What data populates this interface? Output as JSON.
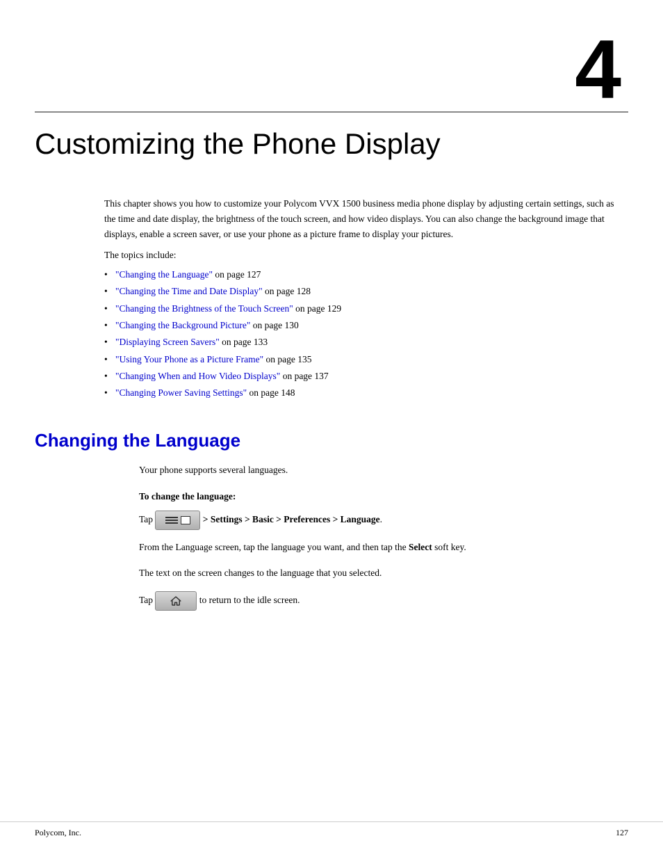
{
  "chapter": {
    "number": "4",
    "title": "Customizing the Phone Display",
    "intro": "This chapter shows you how to customize your Polycom VVX 1500 business media phone display by adjusting certain settings, such as the time and date display, the brightness of the touch screen, and how video displays. You can also change the background image that displays, enable a screen saver, or use your phone as a picture frame to display your pictures.",
    "topics_label": "The topics include:",
    "topics": [
      {
        "link": "\"Changing the Language\"",
        "page_text": " on page ",
        "page": "127"
      },
      {
        "link": "\"Changing the Time and Date Display\"",
        "page_text": " on page ",
        "page": "128"
      },
      {
        "link": "\"Changing the Brightness of the Touch Screen\"",
        "page_text": " on page ",
        "page": "129"
      },
      {
        "link": "\"Changing the Background Picture\"",
        "page_text": " on page ",
        "page": "130"
      },
      {
        "link": "\"Displaying Screen Savers\"",
        "page_text": " on page ",
        "page": "133"
      },
      {
        "link": "\"Using Your Phone as a Picture Frame\"",
        "page_text": " on page ",
        "page": "135"
      },
      {
        "link": "\"Changing When and How Video Displays\"",
        "page_text": " on page ",
        "page": "137"
      },
      {
        "link": "\"Changing Power Saving Settings\"",
        "page_text": " on page ",
        "page": "148"
      }
    ]
  },
  "section": {
    "heading": "Changing the Language",
    "intro": "Your phone supports several languages.",
    "procedure_heading": "To change the language:",
    "step1_pre": "Tap",
    "step1_arrow": ">",
    "step1_post": "Settings > Basic > Preferences > Language",
    "step1_period": ".",
    "step2": "From the Language screen, tap the language you want, and then tap the",
    "step2_bold": "Select",
    "step2_post": "soft key.",
    "step3": "The text on the screen changes to the language that you selected.",
    "step4_pre": "Tap",
    "step4_post": "to return to the idle screen."
  },
  "footer": {
    "company": "Polycom, Inc.",
    "page": "127"
  },
  "icons": {
    "menu_button": "menu-icon",
    "home_button": "home-icon"
  }
}
